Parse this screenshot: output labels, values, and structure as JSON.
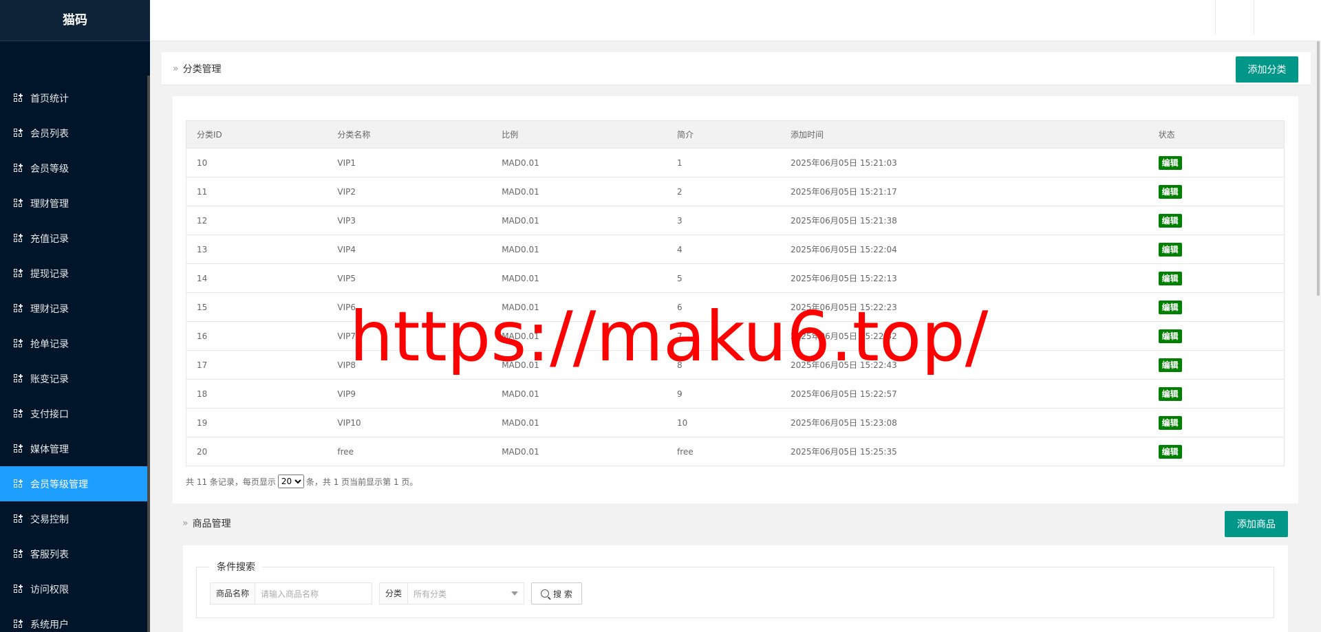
{
  "brand": "猫码",
  "sidebar": {
    "items": [
      {
        "label": "首页统计",
        "active": false
      },
      {
        "label": "会员列表",
        "active": false
      },
      {
        "label": "会员等级",
        "active": false
      },
      {
        "label": "理财管理",
        "active": false
      },
      {
        "label": "充值记录",
        "active": false
      },
      {
        "label": "提现记录",
        "active": false
      },
      {
        "label": "理财记录",
        "active": false
      },
      {
        "label": "抢单记录",
        "active": false
      },
      {
        "label": "账变记录",
        "active": false
      },
      {
        "label": "支付接口",
        "active": false
      },
      {
        "label": "媒体管理",
        "active": false
      },
      {
        "label": "会员等级管理",
        "active": true
      },
      {
        "label": "交易控制",
        "active": false
      },
      {
        "label": "客服列表",
        "active": false
      },
      {
        "label": "访问权限",
        "active": false
      },
      {
        "label": "系统用户",
        "active": false
      }
    ]
  },
  "category_panel": {
    "title": "分类管理",
    "add_button": "添加分类",
    "columns": [
      "分类ID",
      "分类名称",
      "比例",
      "简介",
      "添加时间",
      "状态"
    ],
    "rows": [
      {
        "id": "10",
        "name": "VIP1",
        "ratio": "MAD0.01",
        "intro": "1",
        "time": "2025年06月05日 15:21:03",
        "status": "编辑"
      },
      {
        "id": "11",
        "name": "VIP2",
        "ratio": "MAD0.01",
        "intro": "2",
        "time": "2025年06月05日 15:21:17",
        "status": "编辑"
      },
      {
        "id": "12",
        "name": "VIP3",
        "ratio": "MAD0.01",
        "intro": "3",
        "time": "2025年06月05日 15:21:38",
        "status": "编辑"
      },
      {
        "id": "13",
        "name": "VIP4",
        "ratio": "MAD0.01",
        "intro": "4",
        "time": "2025年06月05日 15:22:04",
        "status": "编辑"
      },
      {
        "id": "14",
        "name": "VIP5",
        "ratio": "MAD0.01",
        "intro": "5",
        "time": "2025年06月05日 15:22:13",
        "status": "编辑"
      },
      {
        "id": "15",
        "name": "VIP6",
        "ratio": "MAD0.01",
        "intro": "6",
        "time": "2025年06月05日 15:22:23",
        "status": "编辑"
      },
      {
        "id": "16",
        "name": "VIP7",
        "ratio": "MAD0.01",
        "intro": "7",
        "time": "2025年06月05日 15:22:32",
        "status": "编辑"
      },
      {
        "id": "17",
        "name": "VIP8",
        "ratio": "MAD0.01",
        "intro": "8",
        "time": "2025年06月05日 15:22:43",
        "status": "编辑"
      },
      {
        "id": "18",
        "name": "VIP9",
        "ratio": "MAD0.01",
        "intro": "9",
        "time": "2025年06月05日 15:22:57",
        "status": "编辑"
      },
      {
        "id": "19",
        "name": "VIP10",
        "ratio": "MAD0.01",
        "intro": "10",
        "time": "2025年06月05日 15:23:08",
        "status": "编辑"
      },
      {
        "id": "20",
        "name": "free",
        "ratio": "MAD0.01",
        "intro": "free",
        "time": "2025年06月05日 15:25:35",
        "status": "编辑"
      }
    ],
    "pager": {
      "prefix": "共 11 条记录，每页显示",
      "page_size": "20",
      "page_size_options": [
        "20"
      ],
      "suffix": "条，共 1 页当前显示第 1 页。"
    }
  },
  "product_panel": {
    "title": "商品管理",
    "add_button": "添加商品",
    "search": {
      "legend": "条件搜索",
      "name_label": "商品名称",
      "name_placeholder": "请输入商品名称",
      "category_label": "分类",
      "category_value": "所有分类",
      "search_button": "搜 索"
    }
  },
  "watermark": "https://maku6.top/",
  "colors": {
    "sidebar_bg": "#001529",
    "active_nav": "#1e9fff",
    "primary_button": "#009688",
    "edit_tag": "#008000",
    "watermark": "#ff0000"
  }
}
